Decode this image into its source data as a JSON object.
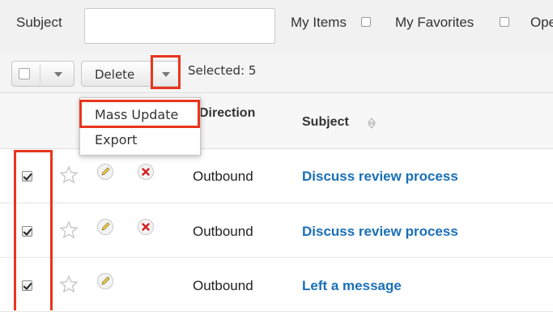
{
  "filter": {
    "subject_label": "Subject",
    "subject_value": "",
    "my_items_label": "My Items",
    "my_favorites_label": "My Favorites",
    "open_label_truncated": "Ope"
  },
  "actions": {
    "delete_label": "Delete",
    "selected_text": "Selected: 5"
  },
  "menu": {
    "items": [
      "Mass Update",
      "Export"
    ],
    "highlighted": "Mass Update"
  },
  "table": {
    "columns": [
      "Direction",
      "Subject"
    ],
    "rows": [
      {
        "direction": "Outbound",
        "subject": "Discuss review process",
        "checked": true,
        "has_delete": true
      },
      {
        "direction": "Outbound",
        "subject": "Discuss review process",
        "checked": true,
        "has_delete": true
      },
      {
        "direction": "Outbound",
        "subject": "Left a message",
        "checked": true,
        "has_delete": false
      }
    ]
  },
  "colors": {
    "highlight_red": "#e8351d",
    "link_blue": "#1a6fb8",
    "delete_red": "#d42020"
  },
  "icons": {
    "favorite": "star-outline-icon",
    "edit": "pencil-icon",
    "remove": "x-circle-icon",
    "sort": "sort-arrows-icon",
    "dropdown": "chevron-down-icon"
  }
}
